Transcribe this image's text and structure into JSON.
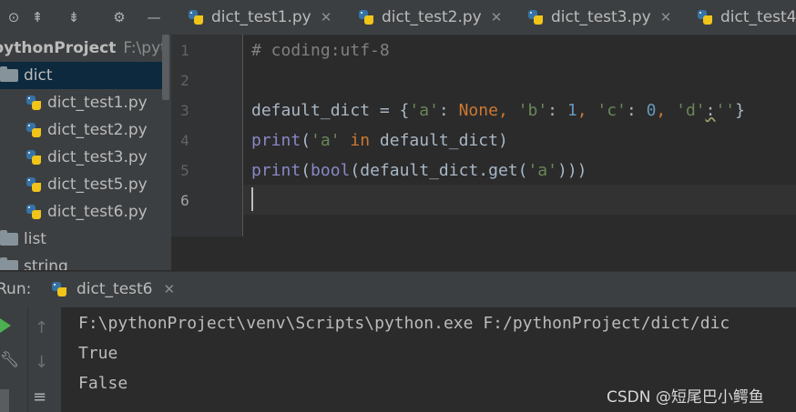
{
  "toolbar": {
    "icons": [
      "collapse-all-icon",
      "expand-icon",
      "collapse-icon",
      "gear-icon",
      "minimize-icon"
    ],
    "glyphs": [
      "⊙",
      "⇞",
      "⇟",
      "⚙",
      "—"
    ]
  },
  "tabs": [
    {
      "label": "dict_test1.py"
    },
    {
      "label": "dict_test2.py"
    },
    {
      "label": "dict_test3.py"
    },
    {
      "label": "dict_test4"
    }
  ],
  "project": {
    "root_name": "pythonProject",
    "root_path": "F:\\pyt",
    "items": [
      {
        "label": "dict",
        "type": "folder"
      },
      {
        "label": "dict_test1.py",
        "type": "file"
      },
      {
        "label": "dict_test2.py",
        "type": "file"
      },
      {
        "label": "dict_test3.py",
        "type": "file"
      },
      {
        "label": "dict_test5.py",
        "type": "file"
      },
      {
        "label": "dict_test6.py",
        "type": "file"
      },
      {
        "label": "list",
        "type": "folder"
      },
      {
        "label": "string",
        "type": "folder"
      }
    ]
  },
  "editor": {
    "line_numbers": [
      "1",
      "2",
      "3",
      "4",
      "5",
      "6"
    ],
    "line1": "# coding:utf-8",
    "line3": {
      "name": "default_dict = {",
      "k1": "'a'",
      "p1": ": ",
      "v1": "None",
      "c1": ", ",
      "k2": "'b'",
      "p2": ": ",
      "v2": "1",
      "c2": ", ",
      "k3": "'c'",
      "p3": ": ",
      "v3": "0",
      "c3": ", ",
      "k4": "'d'",
      "p4": ":",
      "v4": "''",
      "end": "}"
    },
    "line4": {
      "fn": "print",
      "open": "(",
      "s": "'a'",
      "kw": " in ",
      "rest": "default_dict)"
    },
    "line5": {
      "fn": "print",
      "open": "(",
      "bi": "bool",
      "mid": "(default_dict.get(",
      "s": "'a'",
      "end": ")))"
    }
  },
  "run": {
    "label": "Run:",
    "tab": "dict_test6",
    "output": [
      "F:\\pythonProject\\venv\\Scripts\\python.exe F:/pythonProject/dict/dic",
      "True",
      "False"
    ],
    "watermark": "CSDN @短尾巴小鳄鱼"
  }
}
